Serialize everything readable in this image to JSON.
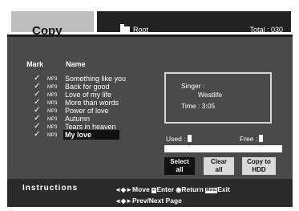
{
  "header": {
    "title": "Copy",
    "folder_label": "Root",
    "total": "Total : 030"
  },
  "columns": {
    "mark": "Mark",
    "name": "Name"
  },
  "tracks": [
    {
      "checked": true,
      "tag": "MP3",
      "name": "Something like you"
    },
    {
      "checked": true,
      "tag": "MP3",
      "name": "Back for good"
    },
    {
      "checked": true,
      "tag": "MP3",
      "name": "Love of my life"
    },
    {
      "checked": true,
      "tag": "MP3",
      "name": "More than words"
    },
    {
      "checked": true,
      "tag": "MP3",
      "name": "Power of love"
    },
    {
      "checked": true,
      "tag": "MP3",
      "name": "Autumn"
    },
    {
      "checked": true,
      "tag": "MP3",
      "name": "Tears in heaven"
    },
    {
      "checked": true,
      "tag": "MP3",
      "name": "My love",
      "selected": true
    }
  ],
  "info": {
    "singer_label": "Singer :",
    "singer": "Westlife",
    "time": "Time :  3:05"
  },
  "capacity": {
    "used_label": "Used :",
    "free_label": "Free :"
  },
  "buttons": {
    "select_all": [
      "Select",
      "all"
    ],
    "clear_all": [
      "Clear",
      "all"
    ],
    "copy_to_hdd": [
      "Copy to",
      "HDD"
    ]
  },
  "instructions": {
    "label": "Instructions",
    "move": "Move",
    "enter": "Enter",
    "return": "Return",
    "menu_key": "Menu",
    "exit": "Exit",
    "prev_next": "Prev/Next Page"
  },
  "icons": {
    "checkmark": "✓",
    "arrows_4way": "◄◆►",
    "arrows_lr": "◄◆►",
    "enter_key": "↵",
    "return_circle": "◉"
  }
}
